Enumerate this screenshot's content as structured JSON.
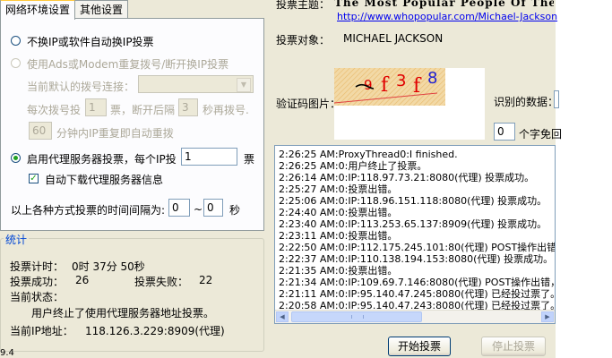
{
  "tabs": {
    "network": "网络环境设置",
    "other": "其他设置"
  },
  "settings": {
    "no_ip_change": "不换IP或软件自动换IP投票",
    "adsl_redial": "使用Ads或Modem重复拨号/断开换IP投票",
    "default_dial_label": "当前默认的拨号连接：",
    "dial_every_prefix": "每次拨号投",
    "dial_votes_value": "1",
    "dial_votes_suffix": "票，断开后隔",
    "disconnect_seconds_value": "3",
    "redial_suffix": "秒再拨号.",
    "repeat_minutes_value": "60",
    "repeat_text": "分钟内IP重复即自动重拨",
    "proxy_label": "启用代理服务器投票，每个IP投",
    "proxy_votes_value": "1",
    "proxy_votes_unit": "票",
    "auto_download_proxy": "自动下载代理服务器信息",
    "interval_label": "以上各种方式投票的时间间隔为:",
    "interval_min": "0",
    "interval_sep": "~",
    "interval_max": "0",
    "interval_unit": "秒"
  },
  "stats": {
    "legend": "统计",
    "time_label": "投票计时：",
    "time_value": "0时 37分 50秒",
    "success_label": "投票成功：",
    "success_value": "26",
    "fail_label": "投票失败：",
    "fail_value": "22",
    "status_label": "当前状态：",
    "status_value": "用户终止了使用代理服务器地址投票。",
    "ip_label": "当前IP地址：",
    "ip_value": "118.126.3.229:8909(代理)"
  },
  "version_fragment": "9.4",
  "vote": {
    "topic_label": "投票主题：",
    "topic_value": "The Most Popular People Of The",
    "url": "http://www.whopopular.com/Michael-Jackson",
    "target_label": "投票对象：",
    "target_value": "MICHAEL JACKSON",
    "captcha_label": "验证码图片：",
    "captcha_text": "9f3f8",
    "recognized_label": "识别的数据：",
    "count_value": "0",
    "count_suffix": "个字免回"
  },
  "log": [
    "2:26:25 AM:ProxyThread0:I finished.",
    "2:26:25 AM:0:用户终止了投票。",
    "2:26:14 AM:0:IP:118.97.73.21:8080(代理) 投票成功。",
    "2:25:27 AM:0:投票出错。",
    "2:25:06 AM:0:IP:118.96.151.118:8080(代理) 投票成功。",
    "2:24:40 AM:0:投票出错。",
    "2:23:40 AM:0:IP:113.253.65.137:8909(代理) 投票成功。",
    "2:23:11 AM:0:投票出错。",
    "2:22:50 AM:0:IP:112.175.245.101:80(代理) POST操作出错，错",
    "2:22:37 AM:0:IP:110.138.194.153:8080(代理) 投票成功。",
    "2:21:35 AM:0:投票出错。",
    "2:21:34 AM:0:IP:109.69.7.146:8080(代理) POST操作出错，错误",
    "2:21:11 AM:0:IP:95.140.47.245:8080(代理) 已经投过票了。",
    "2:20:58 AM:0:IP:95.140.47.243:8080(代理) 已经投过票了。"
  ],
  "buttons": {
    "start": "开始投票",
    "stop": "停止投票"
  }
}
